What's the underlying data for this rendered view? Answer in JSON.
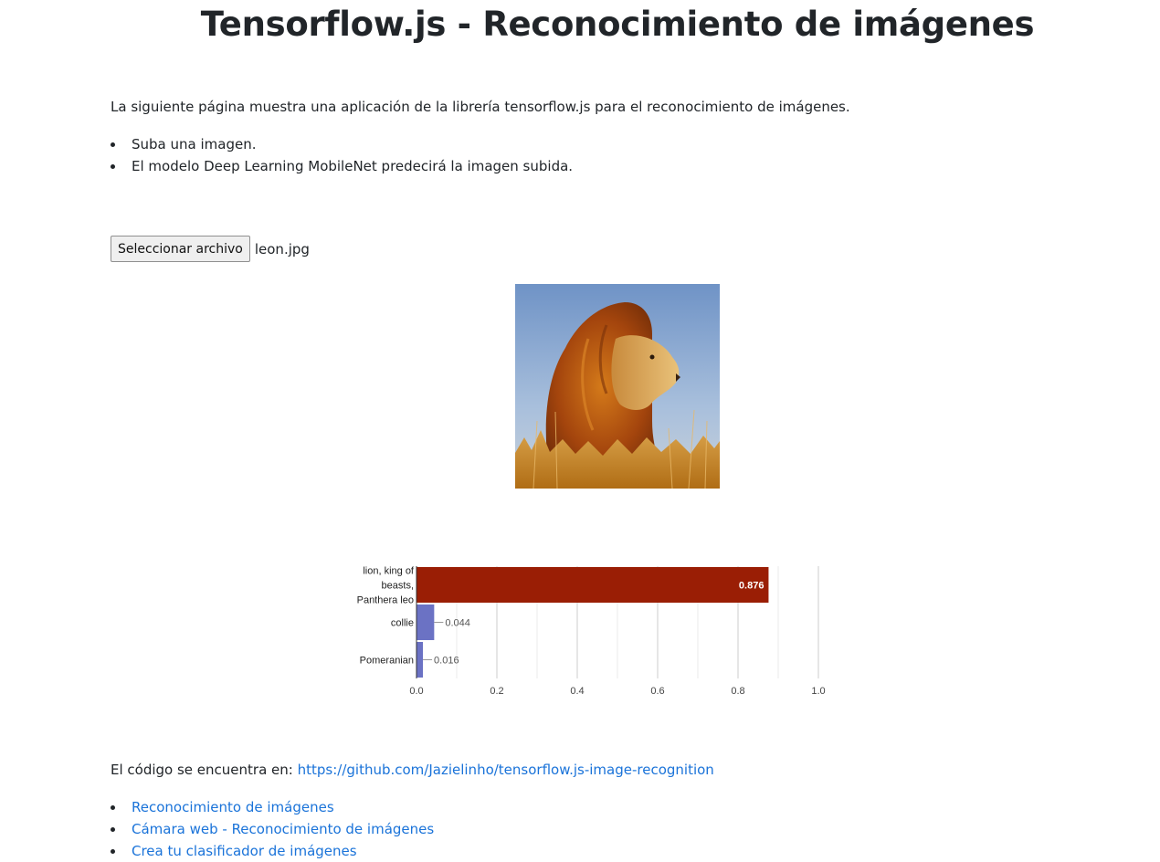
{
  "page": {
    "title": "Tensorflow.js - Reconocimiento de imágenes",
    "intro": "La siguiente página muestra una aplicación de la librería tensorflow.js para el reconocimiento de imágenes.",
    "bullets": [
      "Suba una imagen.",
      "El modelo Deep Learning MobileNet predecirá la imagen subida."
    ]
  },
  "file_input": {
    "button_label": "Seleccionar archivo",
    "file_name": "leon.jpg"
  },
  "preview": {
    "subject": "lion-photo"
  },
  "chart_data": {
    "type": "bar",
    "orientation": "horizontal",
    "categories": [
      [
        "lion, king of",
        "beasts,",
        "Panthera leo"
      ],
      [
        "collie"
      ],
      [
        "Pomeranian"
      ]
    ],
    "values": [
      0.876,
      0.044,
      0.016
    ],
    "value_labels": [
      "0.876",
      "0.044",
      "0.016"
    ],
    "colors": [
      "#9a1e05",
      "#6b72c4",
      "#6b72c4"
    ],
    "xlim": [
      0,
      1.0
    ],
    "xticks": [
      "0.0",
      "0.2",
      "0.4",
      "0.6",
      "0.8",
      "1.0"
    ],
    "grid": true,
    "legend": "none"
  },
  "footer": {
    "code_text": "El código se encuentra en: ",
    "code_link": "https://github.com/Jazielinho/tensorflow.js-image-recognition",
    "links": [
      "Reconocimiento de imágenes",
      "Cámara web - Reconocimiento de imágenes",
      "Crea tu clasificador de imágenes"
    ]
  }
}
